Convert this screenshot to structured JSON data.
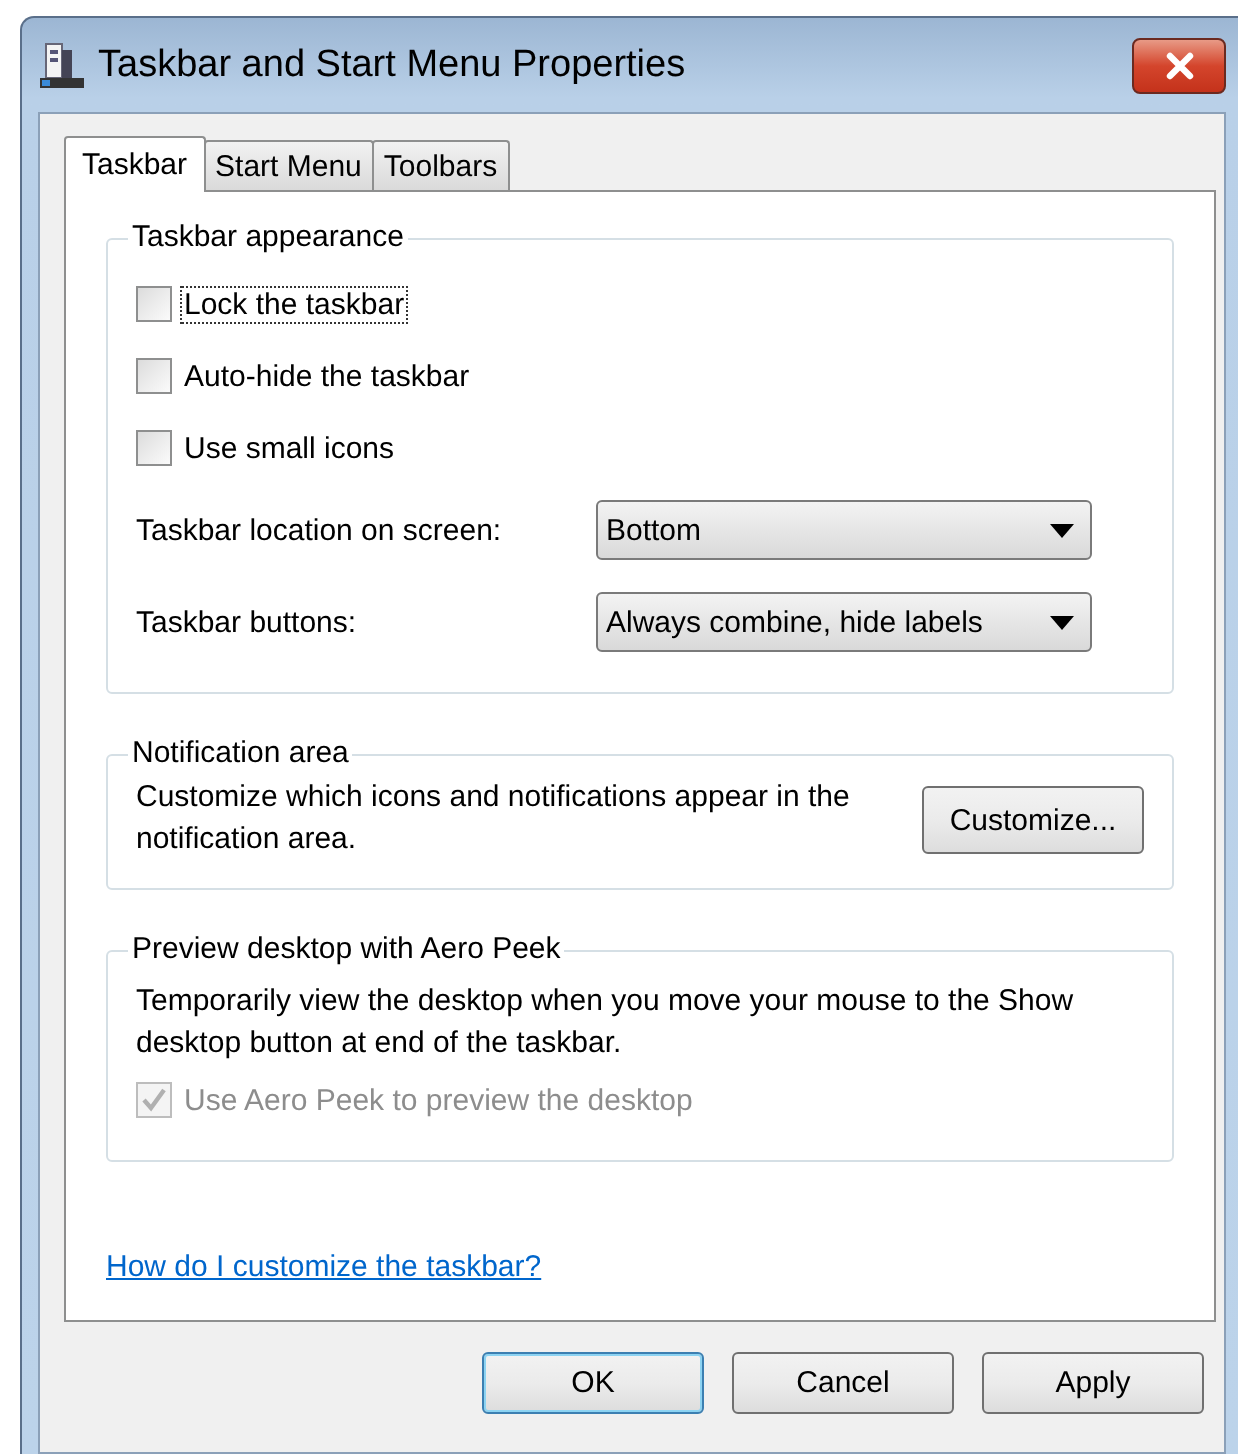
{
  "window": {
    "title": "Taskbar and Start Menu Properties"
  },
  "tabs": [
    {
      "label": "Taskbar",
      "selected": true
    },
    {
      "label": "Start Menu",
      "selected": false
    },
    {
      "label": "Toolbars",
      "selected": false
    }
  ],
  "groups": [
    {
      "title": "Taskbar appearance",
      "items": [
        {
          "kind": "checkbox",
          "label": "Lock the taskbar",
          "checked": false,
          "disabled": false,
          "focused": true
        },
        {
          "kind": "checkbox",
          "label": "Auto-hide the taskbar",
          "checked": false,
          "disabled": false,
          "focused": false
        },
        {
          "kind": "checkbox",
          "label": "Use small icons",
          "checked": false,
          "disabled": false,
          "focused": false
        },
        {
          "kind": "dropdown",
          "label": "Taskbar location on screen:",
          "value": "Bottom"
        },
        {
          "kind": "dropdown",
          "label": "Taskbar buttons:",
          "value": "Always combine, hide labels"
        }
      ]
    },
    {
      "title": "Notification area",
      "items": [
        {
          "kind": "text_button",
          "text": "Customize which icons and notifications appear in the notification area.",
          "button": "Customize..."
        }
      ]
    },
    {
      "title": "Preview desktop with Aero Peek",
      "items": [
        {
          "kind": "paragraph",
          "text": "Temporarily view the desktop when you move your mouse to the Show desktop button at end of the taskbar."
        },
        {
          "kind": "checkbox",
          "label": "Use Aero Peek to preview the desktop",
          "checked": true,
          "disabled": true,
          "focused": false
        }
      ]
    }
  ],
  "help_link": "How do I customize the taskbar?",
  "buttons": [
    {
      "label": "OK",
      "default": true
    },
    {
      "label": "Cancel",
      "default": false
    },
    {
      "label": "Apply",
      "default": false
    }
  ]
}
